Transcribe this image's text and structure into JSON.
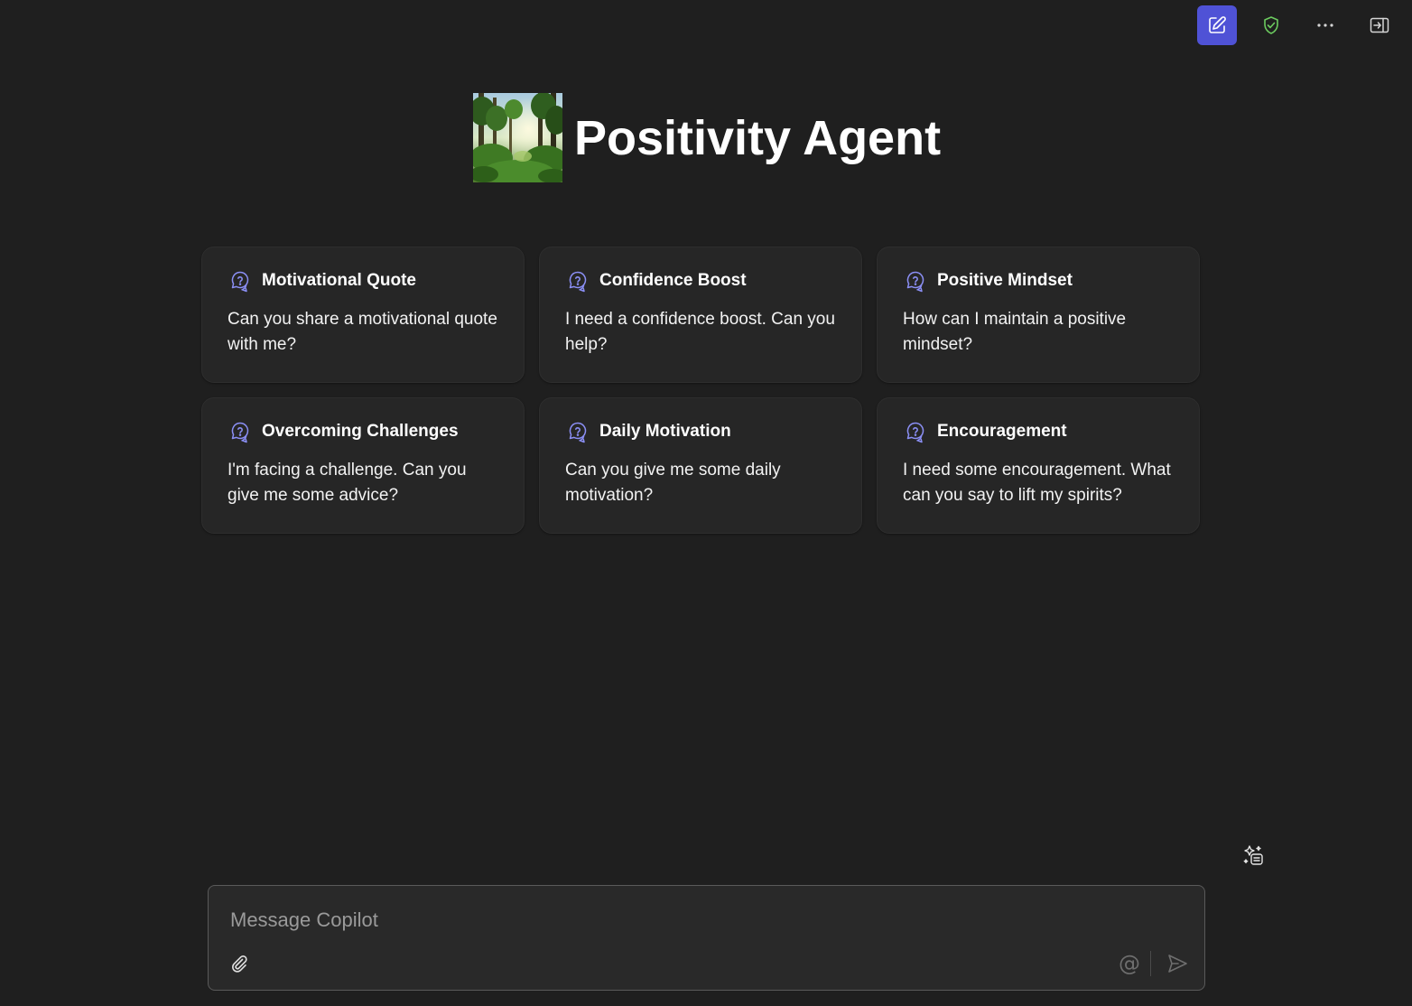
{
  "toolbar": {
    "new_chat_icon": "compose-icon",
    "shield_icon": "shield-check-icon",
    "more_icon": "more-horizontal-icon",
    "panel_icon": "panel-exit-icon",
    "accent_color": "#4f52d6",
    "shield_color": "#6ccb5f"
  },
  "header": {
    "title": "Positivity Agent",
    "avatar": "forest-image"
  },
  "cards": [
    {
      "title": "Motivational Quote",
      "text": "Can you share a motivational quote with me?",
      "icon": "chat-question-icon"
    },
    {
      "title": "Confidence Boost",
      "text": "I need a confidence boost. Can you help?",
      "icon": "chat-question-icon"
    },
    {
      "title": "Positive Mindset",
      "text": "How can I maintain a positive mindset?",
      "icon": "chat-question-icon"
    },
    {
      "title": "Overcoming Challenges",
      "text": "I'm facing a challenge. Can you give me some advice?",
      "icon": "chat-question-icon"
    },
    {
      "title": "Daily Motivation",
      "text": "Can you give me some daily motivation?",
      "icon": "chat-question-icon"
    },
    {
      "title": "Encouragement",
      "text": "I need some encouragement. What can you say to lift my spirits?",
      "icon": "chat-question-icon"
    }
  ],
  "composer": {
    "placeholder": "Message Copilot",
    "value": "",
    "mention_symbol": "@"
  },
  "card_icon_color": "#8b8ff5"
}
